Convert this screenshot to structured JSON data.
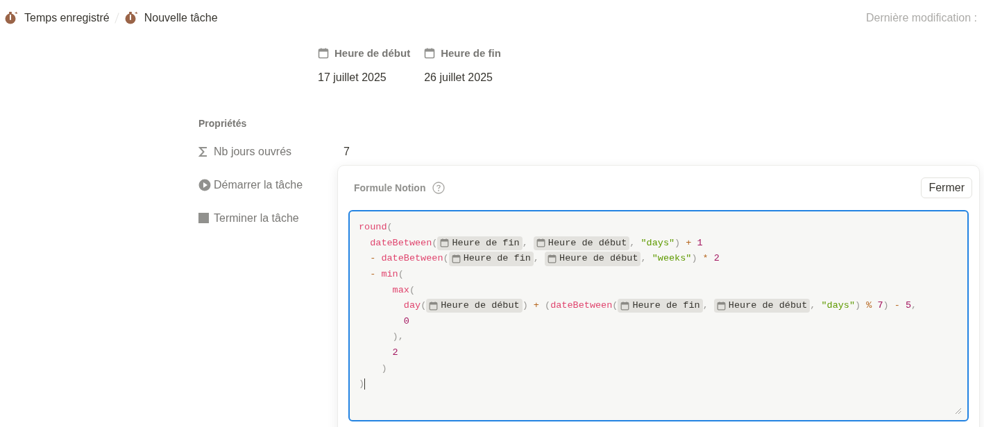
{
  "breadcrumb": [
    {
      "label": "Temps enregistré"
    },
    {
      "label": "Nouvelle tâche"
    }
  ],
  "last_modified": "Dernière modification :",
  "dates": [
    {
      "label": "Heure de début",
      "value": "17 juillet 2025"
    },
    {
      "label": "Heure de fin",
      "value": "26 juillet 2025"
    }
  ],
  "properties_title": "Propriétés",
  "properties": [
    {
      "kind": "formula",
      "label": "Nb jours ouvrés",
      "value": "7"
    },
    {
      "kind": "start",
      "label": "Démarrer la tâche"
    },
    {
      "kind": "stop",
      "label": "Terminer la tâche"
    }
  ],
  "formula_popup": {
    "title": "Formule Notion",
    "close_button": "Fermer",
    "lines": [
      [
        {
          "kind": "fn",
          "text": "round"
        },
        {
          "kind": "punct",
          "text": "("
        }
      ],
      [
        {
          "kind": "fn",
          "text": "  dateBetween"
        },
        {
          "kind": "punct",
          "text": "("
        },
        {
          "kind": "chip",
          "text": "Heure de fin"
        },
        {
          "kind": "punct",
          "text": ", "
        },
        {
          "kind": "chip",
          "text": "Heure de début"
        },
        {
          "kind": "punct",
          "text": ", "
        },
        {
          "kind": "str",
          "text": "\"days\""
        },
        {
          "kind": "punct",
          "text": ") "
        },
        {
          "kind": "op",
          "text": "+"
        },
        {
          "kind": "num",
          "text": " 1"
        }
      ],
      [
        {
          "kind": "op",
          "text": "  -"
        },
        {
          "kind": "fn",
          "text": " dateBetween"
        },
        {
          "kind": "punct",
          "text": "("
        },
        {
          "kind": "chip",
          "text": "Heure de fin"
        },
        {
          "kind": "punct",
          "text": ", "
        },
        {
          "kind": "chip",
          "text": "Heure de début"
        },
        {
          "kind": "punct",
          "text": ", "
        },
        {
          "kind": "str",
          "text": "\"weeks\""
        },
        {
          "kind": "punct",
          "text": ") "
        },
        {
          "kind": "op",
          "text": "*"
        },
        {
          "kind": "num",
          "text": " 2"
        }
      ],
      [
        {
          "kind": "op",
          "text": "  -"
        },
        {
          "kind": "fn",
          "text": " min"
        },
        {
          "kind": "punct",
          "text": "("
        }
      ],
      [
        {
          "kind": "fn",
          "text": "      max"
        },
        {
          "kind": "punct",
          "text": "("
        }
      ],
      [
        {
          "kind": "fn",
          "text": "        day"
        },
        {
          "kind": "punct",
          "text": "("
        },
        {
          "kind": "chip",
          "text": "Heure de début"
        },
        {
          "kind": "punct",
          "text": ") "
        },
        {
          "kind": "op",
          "text": "+"
        },
        {
          "kind": "punct",
          "text": " ("
        },
        {
          "kind": "fn",
          "text": "dateBetween"
        },
        {
          "kind": "punct",
          "text": "("
        },
        {
          "kind": "chip",
          "text": "Heure de fin"
        },
        {
          "kind": "punct",
          "text": ", "
        },
        {
          "kind": "chip",
          "text": "Heure de début"
        },
        {
          "kind": "punct",
          "text": ", "
        },
        {
          "kind": "str",
          "text": "\"days\""
        },
        {
          "kind": "punct",
          "text": ") "
        },
        {
          "kind": "op",
          "text": "%"
        },
        {
          "kind": "num",
          "text": " 7"
        },
        {
          "kind": "punct",
          "text": ") "
        },
        {
          "kind": "op",
          "text": "-"
        },
        {
          "kind": "num",
          "text": " 5"
        },
        {
          "kind": "punct",
          "text": ","
        }
      ],
      [
        {
          "kind": "num",
          "text": "        0"
        }
      ],
      [
        {
          "kind": "punct",
          "text": "      ),"
        }
      ],
      [
        {
          "kind": "num",
          "text": "      2"
        }
      ],
      [
        {
          "kind": "punct",
          "text": "    )"
        }
      ],
      [
        {
          "kind": "punct",
          "text": ")"
        }
      ]
    ]
  }
}
